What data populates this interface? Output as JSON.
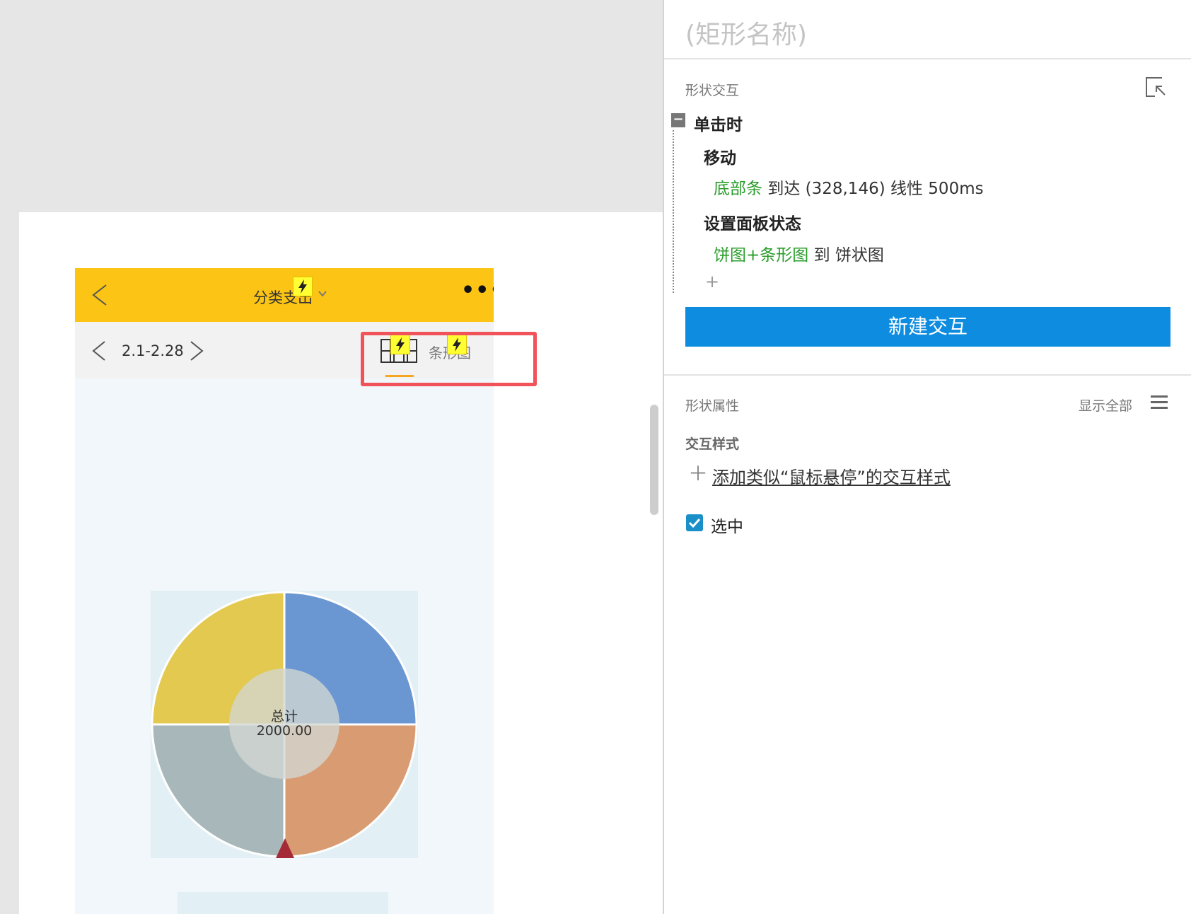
{
  "canvas": {
    "phone": {
      "header": {
        "title": "分类支出",
        "header_color": "#fcc515"
      },
      "subbar": {
        "date_range": "2.1-2.28",
        "tab_label": "条形图",
        "tab_underline_color": "#f5a623"
      },
      "chart": {
        "center_label": "总计",
        "center_value": "2000.00"
      }
    },
    "highlight_color": "#f0545a"
  },
  "chart_data": {
    "type": "pie",
    "values": [
      25,
      25,
      25,
      25
    ],
    "colors": [
      "#6a96d2",
      "#d89b72",
      "#a8b7b9",
      "#e3c94f"
    ],
    "center_text": [
      "总计",
      "2000.00"
    ]
  },
  "panel": {
    "shape_name_placeholder": "(矩形名称)",
    "interaction_section_title": "形状交互",
    "event": "单击时",
    "actions": [
      {
        "title": "移动",
        "target": "底部条",
        "detail": "到达 (328,146) 线性 500ms"
      },
      {
        "title": "设置面板状态",
        "target": "饼图+条形图",
        "detail": "到 饼状图"
      }
    ],
    "add_action": "+",
    "new_interaction_button": "新建交互",
    "properties_section_title": "形状属性",
    "show_all": "显示全部",
    "interaction_style_title": "交互样式",
    "add_style_link": "添加类似“鼠标悬停”的交互样式",
    "selected_checkbox_label": "选中",
    "accent_color": "#0d8ce0",
    "target_color": "#2a9d2a"
  }
}
